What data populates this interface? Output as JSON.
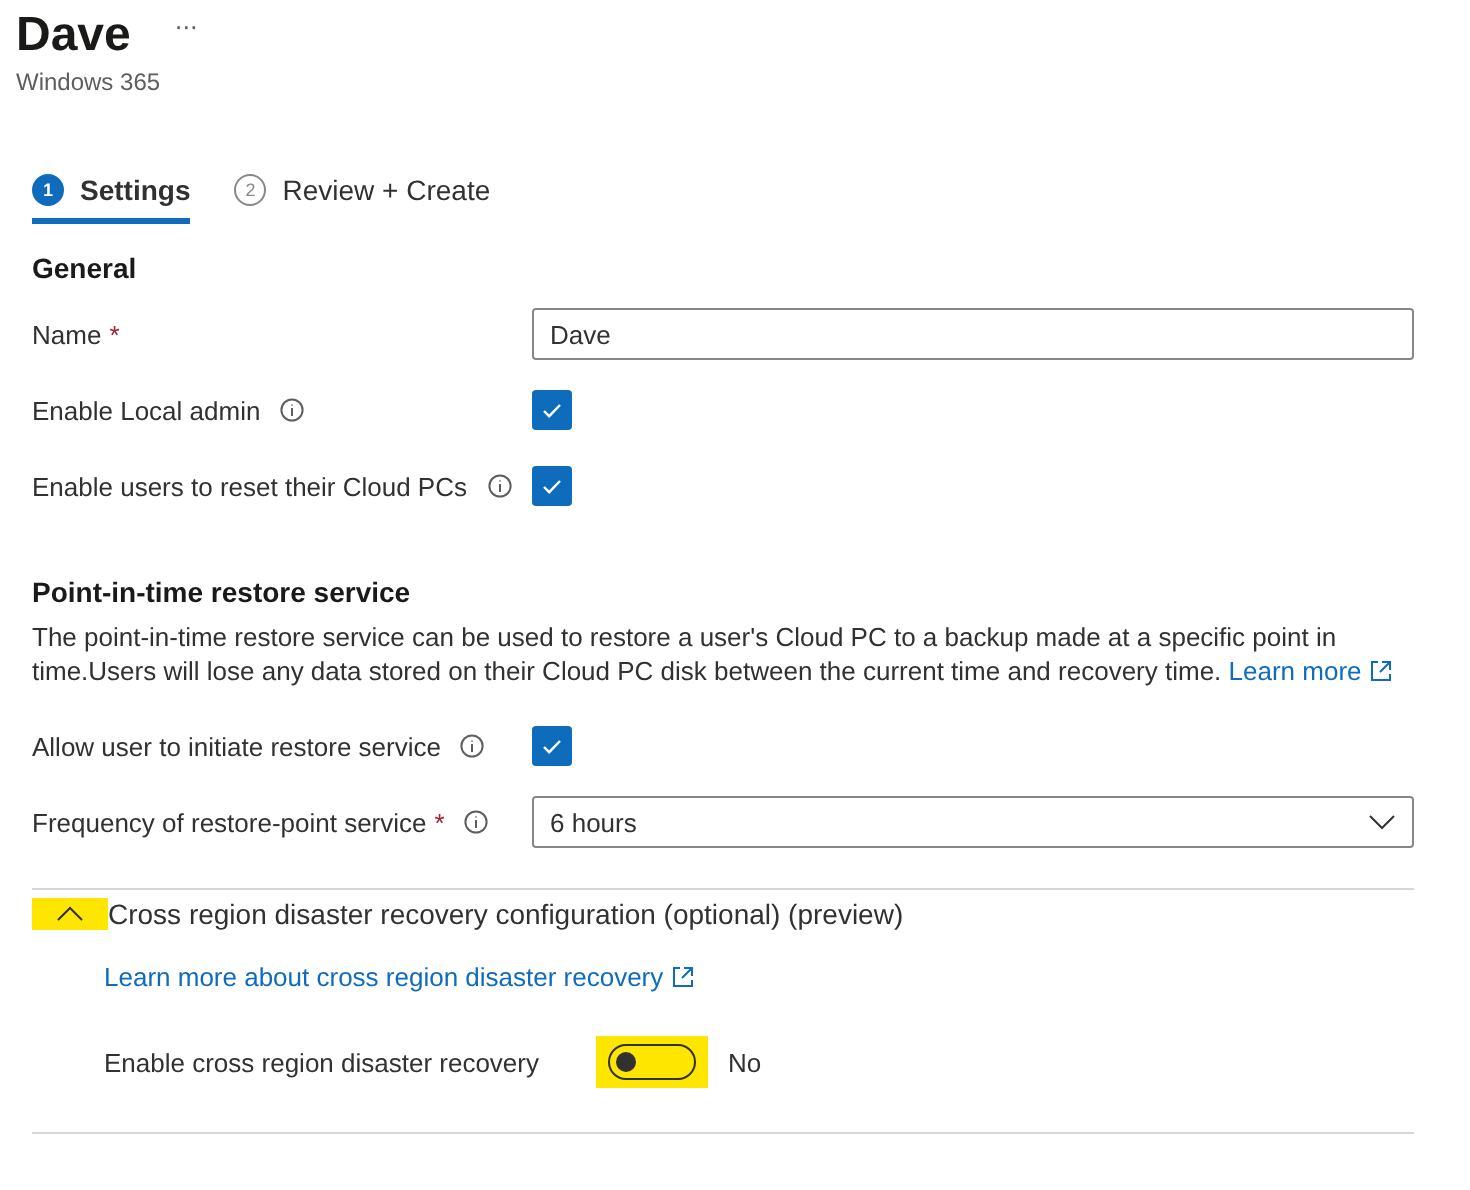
{
  "header": {
    "title": "Dave",
    "more": "···",
    "subtitle": "Windows 365"
  },
  "steps": [
    {
      "number": "1",
      "label": "Settings",
      "selected": true
    },
    {
      "number": "2",
      "label": "Review + Create",
      "selected": false
    }
  ],
  "general": {
    "heading": "General",
    "fields": [
      {
        "kind": "text",
        "label": "Name",
        "required_mark": "*",
        "info": false,
        "value": "Dave"
      },
      {
        "kind": "checkbox",
        "label": "Enable Local admin",
        "info": true,
        "checked": true
      },
      {
        "kind": "checkbox",
        "label": "Enable users to reset their Cloud PCs",
        "info": true,
        "checked": true
      }
    ]
  },
  "restore": {
    "heading": "Point-in-time restore service",
    "description": "The point-in-time restore service can be used to restore a user's Cloud PC to a backup made at a specific point in time.Users will lose any data stored on their Cloud PC disk between the current time and recovery time.",
    "link": "Learn more",
    "fields": [
      {
        "kind": "checkbox",
        "label": "Allow user to initiate restore service",
        "info": true,
        "checked": true
      },
      {
        "kind": "dropdown",
        "label": "Frequency of restore-point service",
        "required_mark": "*",
        "info": true,
        "value": "6 hours"
      }
    ]
  },
  "cross_region": {
    "title": "Cross region disaster recovery configuration (optional) (preview)",
    "expanded": true,
    "highlighted": true,
    "link": "Learn more about cross region disaster recovery",
    "toggle": {
      "label": "Enable cross region disaster recovery",
      "on": false,
      "state_text": "No",
      "highlighted": true
    }
  }
}
